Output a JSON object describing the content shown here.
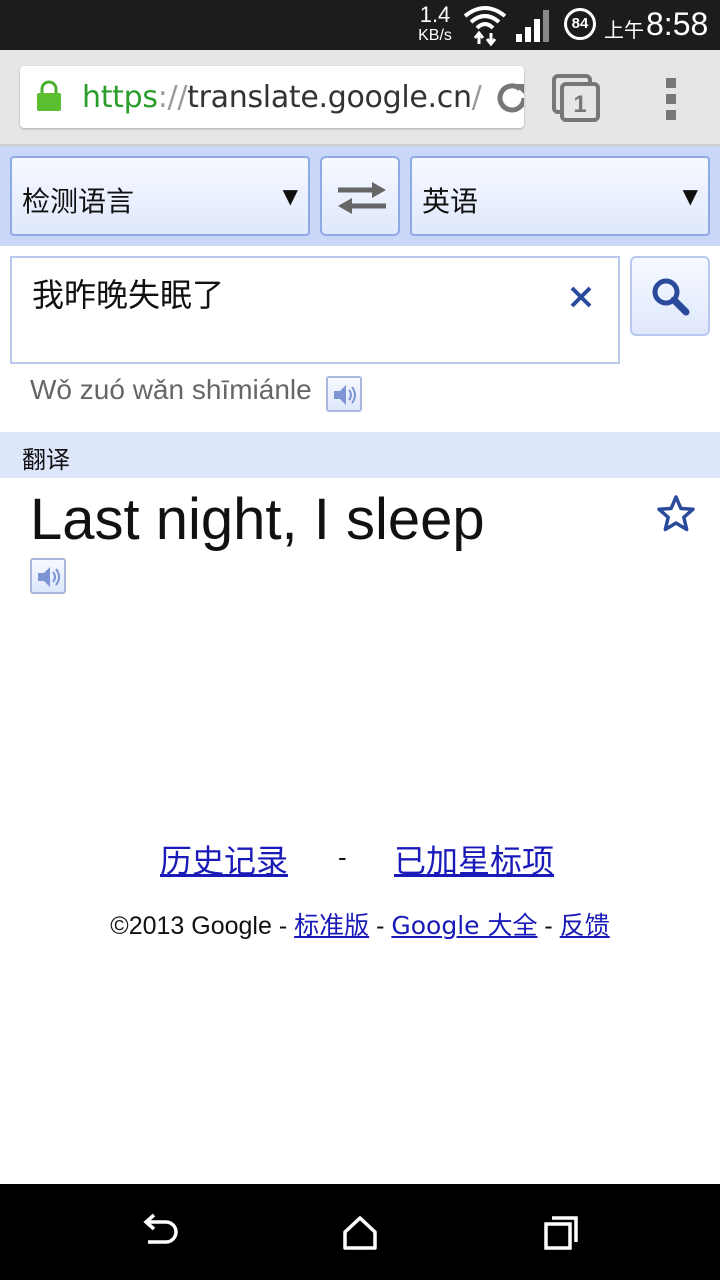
{
  "status_bar": {
    "net_speed_value": "1.4",
    "net_speed_unit": "KB/s",
    "battery_level": "84",
    "ampm": "上午",
    "time": "8:58"
  },
  "browser": {
    "url_scheme": "https",
    "url_sep": "://",
    "url_host": "translate.google.cn",
    "url_path": "/n",
    "tab_count": "1"
  },
  "translator": {
    "source_language": "检测语言",
    "target_language": "英语",
    "input_text": "我昨晚失眠了",
    "romanization": "Wǒ zuó wǎn shīmiánle",
    "section_label": "翻译",
    "translation": "Last night, I sleep"
  },
  "links": {
    "history": "历史记录",
    "separator": "-",
    "starred": "已加星标项"
  },
  "footer": {
    "copyright": "©2013 Google -",
    "standard": "标准版",
    "sep1": " - ",
    "all_google": "Google 大全",
    "sep2": " - ",
    "feedback": "反馈"
  },
  "colors": {
    "link": "#1a1ab8",
    "lang_bar": "#c9d7f8",
    "https_green": "#2a9d2a"
  },
  "icons": [
    "lock-icon",
    "reload-icon",
    "tabs-icon",
    "menu-icon",
    "swap-icon",
    "clear-icon",
    "search-icon",
    "speaker-icon",
    "star-icon",
    "back-icon",
    "home-icon",
    "recent-apps-icon"
  ]
}
